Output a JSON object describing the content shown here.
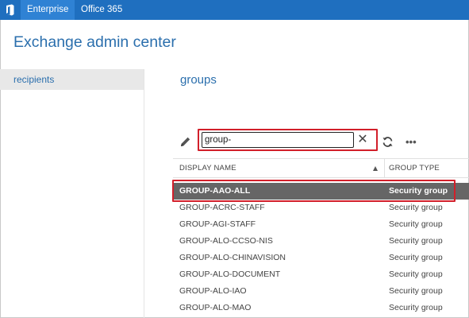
{
  "topbar": {
    "tabs": [
      {
        "label": "Enterprise",
        "active": true
      },
      {
        "label": "Office 365",
        "active": false
      }
    ],
    "logo_icon": "office-logo-icon",
    "bg_color": "#1f6fbf"
  },
  "app": {
    "title": "Exchange admin center"
  },
  "sidebar": {
    "items": [
      {
        "label": "recipients",
        "selected": true
      }
    ]
  },
  "main": {
    "section_title": "groups",
    "toolbar": {
      "edit_icon": "pencil-icon",
      "search_value": "group-",
      "clear_icon": "close-icon",
      "refresh_icon": "refresh-icon",
      "more_label": "•••"
    },
    "table": {
      "columns": [
        "DISPLAY NAME",
        "GROUP TYPE"
      ],
      "rows": [
        {
          "name": "GROUP-AAO-ALL",
          "type": "Security group",
          "selected": true
        },
        {
          "name": "GROUP-ACRC-STAFF",
          "type": "Security group"
        },
        {
          "name": "GROUP-AGI-STAFF",
          "type": "Security group"
        },
        {
          "name": "GROUP-ALO-CCSO-NIS",
          "type": "Security group"
        },
        {
          "name": "GROUP-ALO-CHINAVISION",
          "type": "Security group"
        },
        {
          "name": "GROUP-ALO-DOCUMENT",
          "type": "Security group"
        },
        {
          "name": "GROUP-ALO-IAO",
          "type": "Security group"
        },
        {
          "name": "GROUP-ALO-MAO",
          "type": "Security group"
        }
      ]
    }
  },
  "colors": {
    "accent": "#2b6fad",
    "highlight": "#d21f2a",
    "selected_row": "#666666"
  }
}
